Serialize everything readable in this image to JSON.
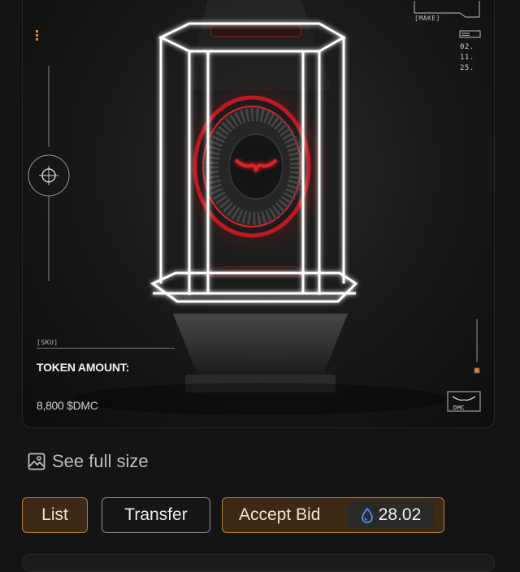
{
  "nft_card": {
    "sku_label": "[SKU]",
    "token_label": "TOKEN AMOUNT:",
    "token_value": "8,800 $DMC",
    "make_label": "[MAKE]",
    "date_text": "02.\n11.\n25.",
    "logo_text": "DMC"
  },
  "actions": {
    "see_full_size": "See full size",
    "list_label": "List",
    "transfer_label": "Transfer",
    "accept_bid_label": "Accept Bid",
    "bid_amount": "28.02"
  },
  "colors": {
    "accent_orange": "#b8803a",
    "accent_red": "#e0202a",
    "droplet_blue": "#4a8ef0"
  }
}
